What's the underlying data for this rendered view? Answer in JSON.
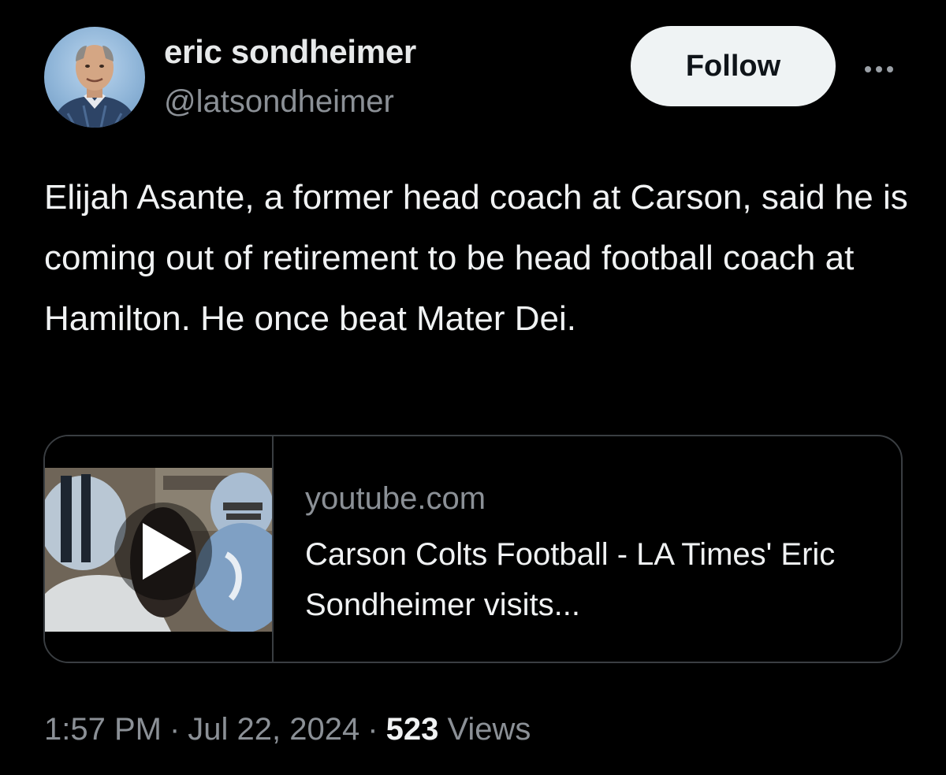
{
  "author": {
    "display_name": "eric sondheimer",
    "handle": "@latsondheimer",
    "avatar_icon": "user-avatar-photo"
  },
  "actions": {
    "follow_label": "Follow",
    "more_icon": "more-dots-icon"
  },
  "tweet": {
    "text": "Elijah Asante, a former head coach at Carson, said he is coming out of retirement to be head football coach at Hamilton. He once beat Mater Dei."
  },
  "link_card": {
    "domain": "youtube.com",
    "title": "Carson Colts Football - LA Times' Eric Sondheimer visits...",
    "thumbnail_icon": "video-thumbnail",
    "play_icon": "play-icon"
  },
  "meta": {
    "time": "1:57 PM",
    "separator": "·",
    "date": "Jul 22, 2024",
    "views_count": "523",
    "views_label": "Views"
  },
  "colors": {
    "background": "#000000",
    "text_primary": "#e7e9ea",
    "text_secondary": "#8b9096",
    "follow_button_bg": "#eff3f4",
    "border": "#3a3e42"
  }
}
